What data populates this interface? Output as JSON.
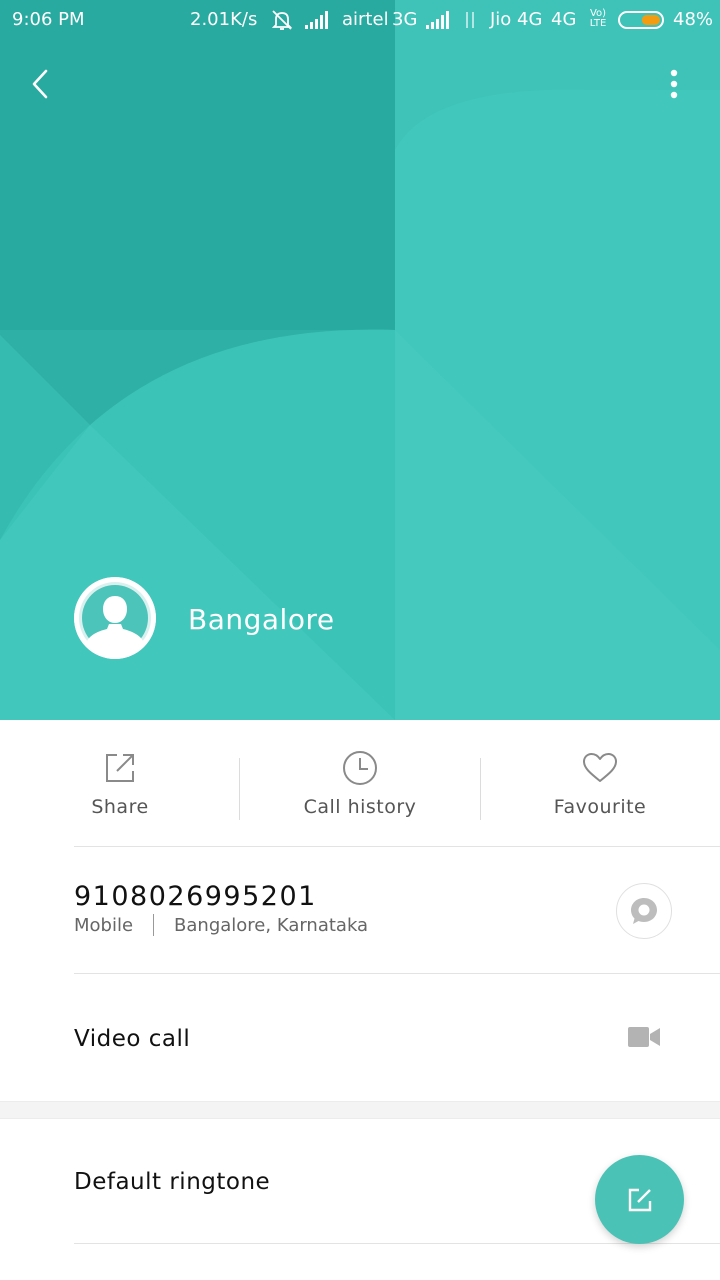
{
  "status_bar": {
    "time": "9:06 PM",
    "speed": "2.01K/s",
    "carrier1": "airtel",
    "net1": "3G",
    "carrier2": "Jio",
    "net2": "4G",
    "net3": "4G",
    "volte_top": "Vo)",
    "volte_bottom": "LTE",
    "battery": "48%",
    "battery_level": 0.48,
    "battery_color": "#f39c12"
  },
  "colors": {
    "header_teal": "#36bbb0",
    "fab_teal": "#4bc2b6"
  },
  "toolbar": {
    "back_icon": "chevron-left-icon",
    "more_icon": "more-vertical-icon"
  },
  "contact": {
    "name": "Bangalore"
  },
  "actions": [
    {
      "label": "Share",
      "icon": "share-icon"
    },
    {
      "label": "Call history",
      "icon": "clock-icon"
    },
    {
      "label": "Favourite",
      "icon": "heart-icon"
    }
  ],
  "phone": {
    "number": "9108026995201",
    "type": "Mobile",
    "location": "Bangalore, Karnataka"
  },
  "video_call": {
    "label": "Video call"
  },
  "ringtone": {
    "label": "Default ringtone"
  }
}
